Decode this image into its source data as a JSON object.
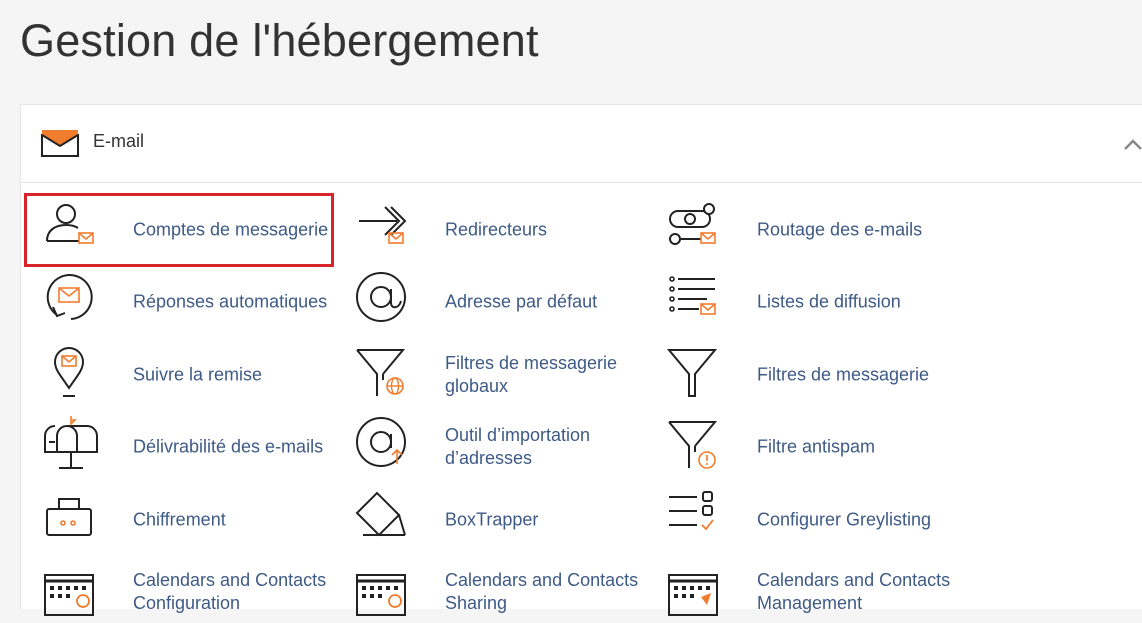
{
  "page": {
    "title": "Gestion de l'hébergement"
  },
  "section": {
    "title": "E-mail",
    "icon": "envelope-icon",
    "collapse_icon": "chevron-up-icon"
  },
  "items": [
    {
      "label": "Comptes de messagerie",
      "icon": "user-mail-icon",
      "highlighted": true
    },
    {
      "label": "Redirecteurs",
      "icon": "forward-arrow-icon"
    },
    {
      "label": "Routage des e-mails",
      "icon": "routing-icon"
    },
    {
      "label": "Réponses automatiques",
      "icon": "auto-reply-icon"
    },
    {
      "label": "Adresse par défaut",
      "icon": "at-sign-icon"
    },
    {
      "label": "Listes de diffusion",
      "icon": "mailing-list-icon"
    },
    {
      "label": "Suivre la remise",
      "icon": "location-pin-icon"
    },
    {
      "label": "Filtres de messagerie\nglobaux",
      "icon": "global-filter-icon"
    },
    {
      "label": "Filtres de messagerie",
      "icon": "filter-icon"
    },
    {
      "label": "Délivrabilité des e-mails",
      "icon": "mailbox-icon"
    },
    {
      "label": "Outil d’importation\nd’adresses",
      "icon": "import-at-icon"
    },
    {
      "label": "Filtre antispam",
      "icon": "spam-filter-icon"
    },
    {
      "label": "Chiffrement",
      "icon": "encryption-icon"
    },
    {
      "label": "BoxTrapper",
      "icon": "boxtrapper-icon"
    },
    {
      "label": "Configurer Greylisting",
      "icon": "greylisting-icon"
    },
    {
      "label": "Calendars and Contacts\nConfiguration",
      "icon": "calendar-gear-icon"
    },
    {
      "label": "Calendars and Contacts\nSharing",
      "icon": "calendar-share-icon"
    },
    {
      "label": "Calendars and Contacts\nManagement",
      "icon": "calendar-manage-icon"
    }
  ],
  "colors": {
    "accent": "#f07c2e",
    "link": "#3e5a86",
    "highlight": "#d8232a"
  }
}
